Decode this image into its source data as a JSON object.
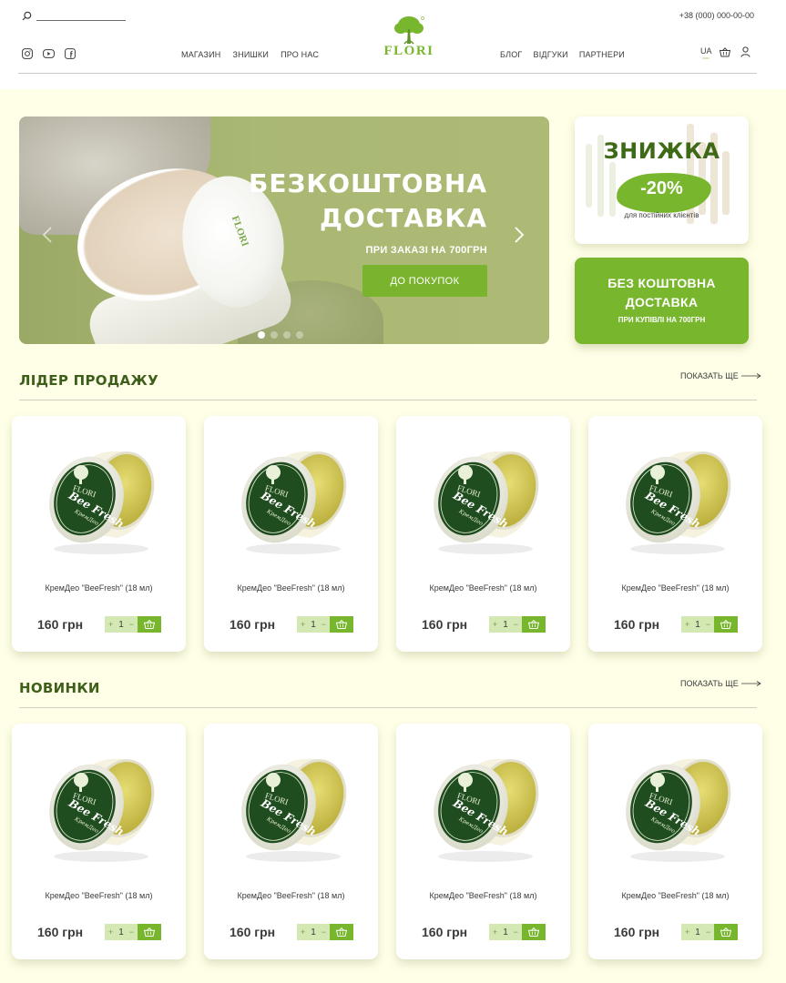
{
  "header": {
    "search": {
      "placeholder": ""
    },
    "phone": "+38 (000) 000-00-00",
    "nav_left": [
      "МАГАЗИН",
      "ЗНИШКИ",
      "ПРО НАС"
    ],
    "nav_right": [
      "БЛОГ",
      "ВІДГУКИ",
      "ПАРТНЕРИ"
    ],
    "logo_text": "FLORI",
    "language": "UA",
    "socials": [
      "instagram-icon",
      "youtube-icon",
      "facebook-icon"
    ]
  },
  "hero": {
    "title_line1": "БЕЗКОШТОВНА",
    "title_line2": "ДОСТАВКА",
    "subtitle": "ПРИ ЗАКАЗІ НА 700ГРН",
    "cta": "ДО ПОКУПОК",
    "slide_count": 4,
    "active_slide": 1
  },
  "promo_discount": {
    "title": "ЗНИЖКА",
    "value": "-20%",
    "note": "для постійних клієнтів"
  },
  "promo_delivery": {
    "title_line1": "БЕЗ КОШТОВНА",
    "title_line2": "ДОСТАВКА",
    "note": "ПРИ КУПІВЛІ НА 700ГРН"
  },
  "sections": [
    {
      "title": "ЛІДЕР ПРОДАЖУ",
      "show_more": "ПОКАЗАТЬ ЩЕ",
      "products": [
        {
          "name": "КремДео \"BeeFresh\" (18 мл)",
          "price": "160 грн",
          "qty": "1"
        },
        {
          "name": "КремДео \"BeeFresh\" (18 мл)",
          "price": "160 грн",
          "qty": "1"
        },
        {
          "name": "КремДео \"BeeFresh\" (18 мл)",
          "price": "160 грн",
          "qty": "1"
        },
        {
          "name": "КремДео \"BeeFresh\" (18 мл)",
          "price": "160 грн",
          "qty": "1"
        }
      ]
    },
    {
      "title": "НОВИНКИ",
      "show_more": "ПОКАЗАТЬ ЩЕ",
      "products": [
        {
          "name": "КремДео \"BeeFresh\" (18 мл)",
          "price": "160 грн",
          "qty": "1"
        },
        {
          "name": "КремДео \"BeeFresh\" (18 мл)",
          "price": "160 грн",
          "qty": "1"
        },
        {
          "name": "КремДео \"BeeFresh\" (18 мл)",
          "price": "160 грн",
          "qty": "1"
        },
        {
          "name": "КремДео \"BeeFresh\" (18 мл)",
          "price": "160 грн",
          "qty": "1"
        }
      ]
    }
  ],
  "stepper": {
    "minus": "−",
    "plus": "+"
  },
  "colors": {
    "brand_green": "#78b62e",
    "dark_green": "#3e5f1a",
    "page_bg": "#ffffe8",
    "stepper_bg": "#d3e8b3"
  }
}
